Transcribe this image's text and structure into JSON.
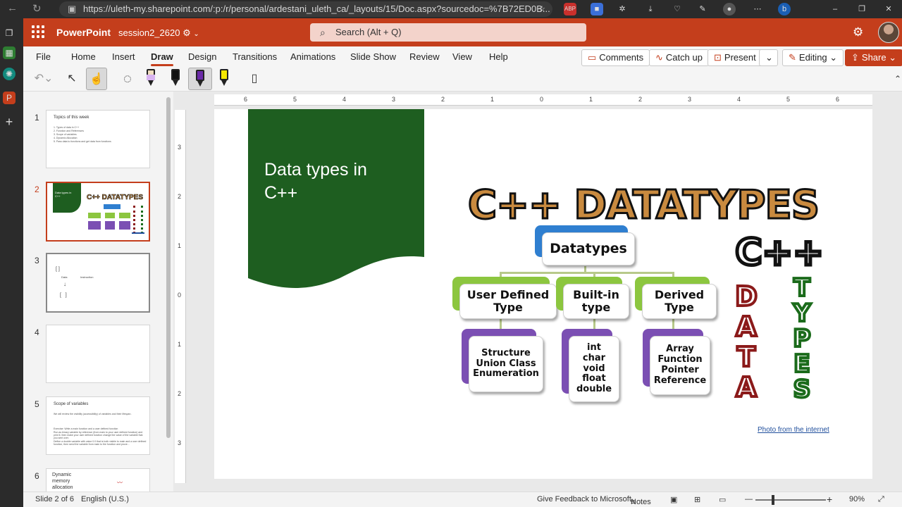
{
  "browser": {
    "url": "https://uleth-my.sharepoint.com/:p:/r/personal/ardestani_uleth_ca/_layouts/15/Doc.aspx?sourcedoc=%7B72ED0B..."
  },
  "app": {
    "name": "PowerPoint",
    "doc_name": "session2_2620",
    "search_placeholder": "Search (Alt + Q)"
  },
  "ribbon": {
    "tabs": [
      "File",
      "Home",
      "Insert",
      "Draw",
      "Design",
      "Transitions",
      "Animations",
      "Slide Show",
      "Review",
      "View",
      "Help"
    ],
    "active_tab": "Draw",
    "comments_label": "Comments",
    "catchup_label": "Catch up",
    "present_label": "Present",
    "editing_label": "Editing",
    "share_label": "Share"
  },
  "thumbnails": {
    "numbers": [
      "1",
      "2",
      "3",
      "4",
      "5",
      "6"
    ],
    "slide1": {
      "title": "Topics of this week",
      "items": [
        "1.   Types of data in C++",
        "2.   Function and References",
        "3.   Scope of variables",
        "4.   Dynamic Allocation",
        "5.   Pass data to functions and get data from functions"
      ]
    },
    "slide2": {
      "title": "Data types in C++"
    },
    "slide3": {
      "labels": [
        "Data",
        "Instruction"
      ]
    },
    "slide5": {
      "title": "Scope of variables",
      "items": [
        "We will review the visibility (accessibility) of variables and their lifespan.",
        "Exercise: Write a main function and a user defined function",
        "Run as binary variable by reference (from main to your user defined function) and",
        "print it, then make your user defined function change the value of the variable that",
        "you sent over.",
        "Define a double variable with value 0.0 that is both visible to main and a user defined",
        "function, then send the variable from main to the function and prove..."
      ]
    },
    "slide6": {
      "title": "Dynamic memory allocation"
    }
  },
  "ruler": {
    "h": [
      "6",
      "5",
      "4",
      "3",
      "2",
      "1",
      "0",
      "1",
      "2",
      "3",
      "4",
      "5",
      "6"
    ],
    "v": [
      "3",
      "2",
      "1",
      "0",
      "1",
      "2",
      "3"
    ]
  },
  "slide": {
    "title": "Data types in C++",
    "link": "Photo from the internet",
    "diagram": {
      "heading": "C++ DATATYPES",
      "root": "Datatypes",
      "children": [
        {
          "label": "User Defined Type",
          "items": "Structure Union Class Enumeration"
        },
        {
          "label": "Built-in type",
          "items": "int char void float double"
        },
        {
          "label": "Derived Type",
          "items": "Array Function Pointer Reference"
        }
      ],
      "side_cpp": "C++",
      "side_data": [
        "D",
        "A",
        "T",
        "A"
      ],
      "side_types": [
        "T",
        "Y",
        "P",
        "E",
        "S"
      ]
    }
  },
  "status": {
    "slide_info": "Slide 2 of 6",
    "language": "English (U.S.)",
    "feedback": "Give Feedback to Microsoft",
    "notes": "Notes",
    "zoom": "90%"
  },
  "colors": {
    "brand": "#c43e1c",
    "slide_green": "#1e5e20",
    "heading_fill": "#c98a3f",
    "blue_box": "#2f7fd0",
    "green_box": "#8cc63f",
    "purple_box": "#7b4fb3",
    "data_red": "#8b1a1a",
    "types_green": "#1b6b1b"
  }
}
